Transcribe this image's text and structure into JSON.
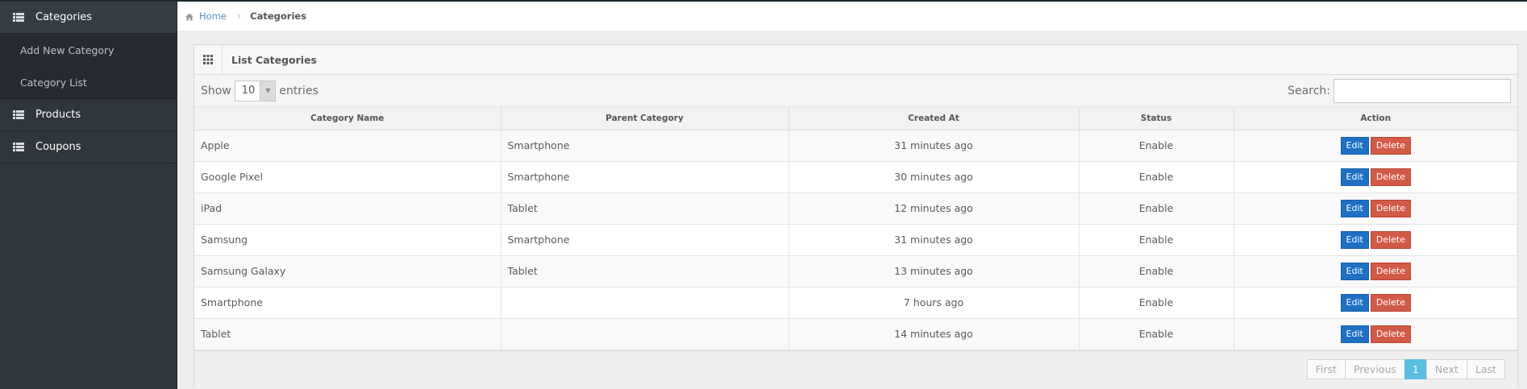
{
  "sidebar": {
    "items": [
      {
        "label": "Categories",
        "icon": "list-icon"
      },
      {
        "label": "Products",
        "icon": "list-icon"
      },
      {
        "label": "Coupons",
        "icon": "list-icon"
      }
    ],
    "submenu": [
      {
        "label": "Add New Category"
      },
      {
        "label": "Category List"
      }
    ]
  },
  "breadcrumb": {
    "home": "Home",
    "current": "Categories"
  },
  "widget": {
    "title": "List Categories"
  },
  "controls": {
    "show_label": "Show",
    "entries_value": "10",
    "entries_label": "entries",
    "search_label": "Search:",
    "search_value": ""
  },
  "table": {
    "columns": [
      "Category Name",
      "Parent Category",
      "Created At",
      "Status",
      "Action"
    ],
    "rows": [
      [
        "Apple",
        "Smartphone",
        "31 minutes ago",
        "Enable"
      ],
      [
        "Google Pixel",
        "Smartphone",
        "30 minutes ago",
        "Enable"
      ],
      [
        "iPad",
        "Tablet",
        "12 minutes ago",
        "Enable"
      ],
      [
        "Samsung",
        "Smartphone",
        "31 minutes ago",
        "Enable"
      ],
      [
        "Samsung Galaxy",
        "Tablet",
        "13 minutes ago",
        "Enable"
      ],
      [
        "Smartphone",
        "",
        "7 hours ago",
        "Enable"
      ],
      [
        "Tablet",
        "",
        "14 minutes ago",
        "Enable"
      ]
    ],
    "edit_label": "Edit",
    "delete_label": "Delete"
  },
  "pagination": {
    "first": "First",
    "previous": "Previous",
    "current": "1",
    "next": "Next",
    "last": "Last"
  },
  "colors": {
    "sidebar": "#2f363d",
    "edit": "#1f6fc5",
    "delete": "#d15b47",
    "active_page": "#5bc0de"
  }
}
